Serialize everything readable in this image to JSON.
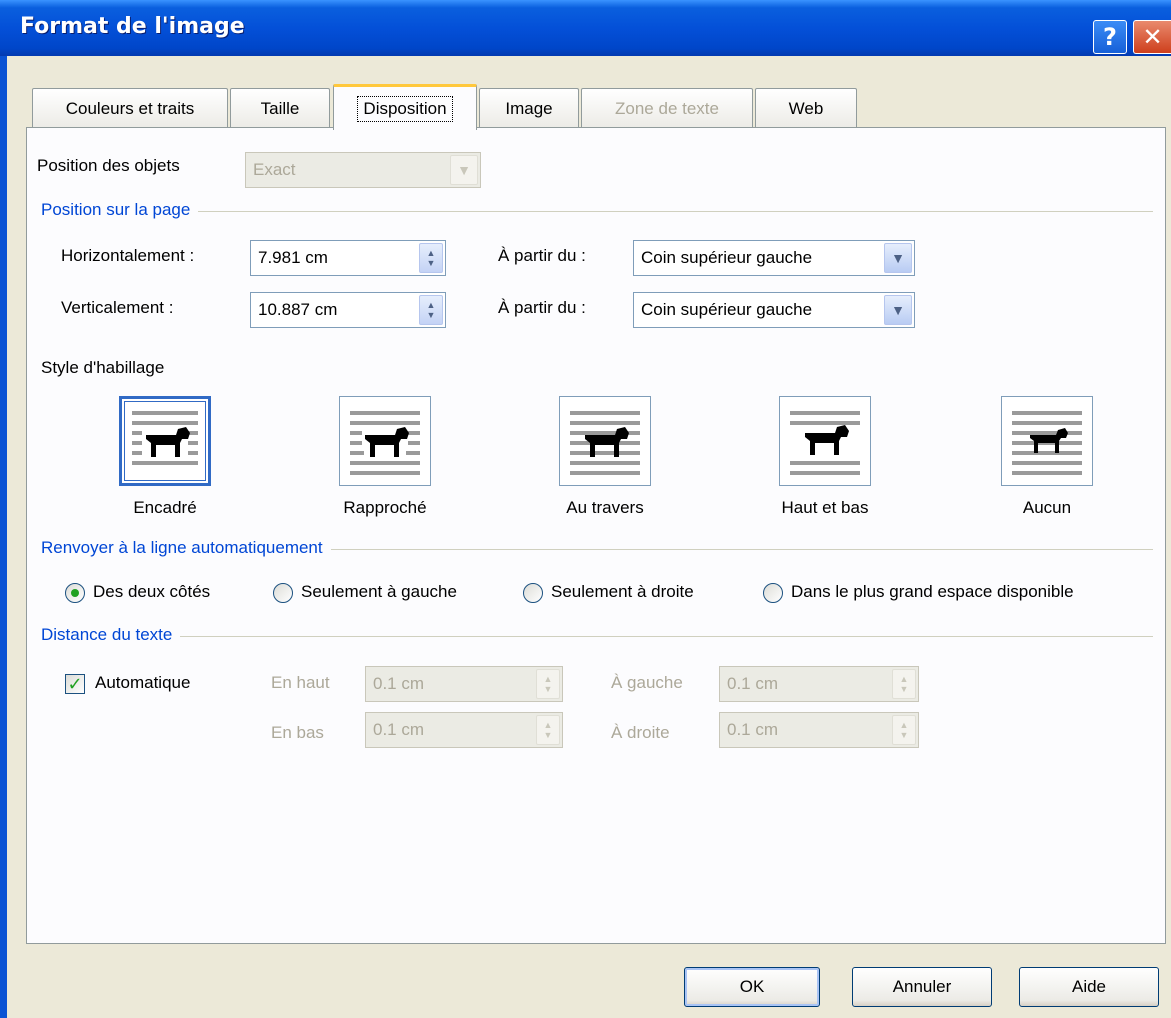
{
  "window": {
    "title": "Format de l'image",
    "help_glyph": "?",
    "close_glyph": "✕"
  },
  "tabs": [
    {
      "label": "Couleurs et traits"
    },
    {
      "label": "Taille"
    },
    {
      "label": "Disposition",
      "active": true
    },
    {
      "label": "Image"
    },
    {
      "label": "Zone de texte",
      "disabled": true
    },
    {
      "label": "Web"
    }
  ],
  "object_position": {
    "label": "Position des objets",
    "value": "Exact"
  },
  "page_position": {
    "title": "Position sur la page",
    "horizontal_label": "Horizontalement :",
    "horizontal_value": "7.981 cm",
    "vertical_label": "Verticalement :",
    "vertical_value": "10.887 cm",
    "from_label": "À partir du :",
    "from_h_value": "Coin supérieur gauche",
    "from_v_value": "Coin supérieur gauche"
  },
  "wrap_style": {
    "title": "Style d'habillage",
    "options": [
      {
        "label": "Encadré",
        "selected": true
      },
      {
        "label": "Rapproché"
      },
      {
        "label": "Au travers"
      },
      {
        "label": "Haut et bas"
      },
      {
        "label": "Aucun"
      }
    ]
  },
  "wrap_text": {
    "title": "Renvoyer à la ligne automatiquement",
    "options": [
      {
        "label": "Des deux côtés",
        "checked": true
      },
      {
        "label": "Seulement à gauche"
      },
      {
        "label": "Seulement à droite"
      },
      {
        "label": "Dans le plus grand espace disponible"
      }
    ]
  },
  "text_distance": {
    "title": "Distance du texte",
    "auto_label": "Automatique",
    "auto_checked": true,
    "top_label": "En haut",
    "top_value": "0.1 cm",
    "bottom_label": "En bas",
    "bottom_value": "0.1 cm",
    "left_label": "À gauche",
    "left_value": "0.1 cm",
    "right_label": "À droite",
    "right_value": "0.1 cm"
  },
  "buttons": {
    "ok": "OK",
    "cancel": "Annuler",
    "help": "Aide"
  },
  "colors": {
    "titlebar": "#0450D8",
    "group_title": "#0046D5",
    "radio_dot": "#21A121",
    "dialog_bg": "#ECE9D8"
  }
}
